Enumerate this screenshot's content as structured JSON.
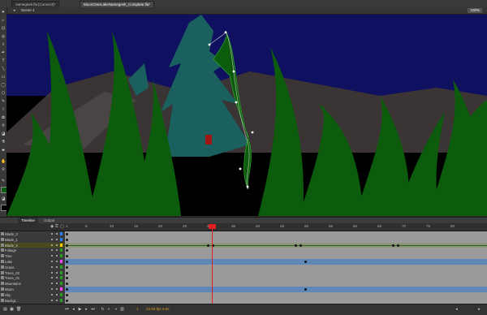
{
  "tabs": [
    {
      "label": "namegeek.fla [Connect]*",
      "active": false
    },
    {
      "label": "MoonOverLakeNamegeek_Complete.fla*",
      "active": true
    }
  ],
  "stage": {
    "scene_label": "Scene 1",
    "zoom": "100%"
  },
  "timeline": {
    "tabs": [
      "Timeline",
      "Output"
    ],
    "frame_numbers": [
      "1",
      "5",
      "10",
      "15",
      "20",
      "25",
      "30",
      "35",
      "40",
      "45",
      "50",
      "55",
      "60",
      "65",
      "70",
      "75",
      "80"
    ],
    "layers": [
      {
        "name": "Blade_3",
        "color": "#2a7fff",
        "keyframes": [
          1
        ]
      },
      {
        "name": "Blade_1",
        "color": "#2a7fff",
        "keyframes": [
          1
        ]
      },
      {
        "name": "Blade_2",
        "color": "#ffd000",
        "keyframes": [
          1,
          30,
          31,
          48,
          49,
          68,
          69
        ],
        "selected": true
      },
      {
        "name": "Foliage",
        "color": "#28a028",
        "keyframes": [
          1
        ]
      },
      {
        "name": "Tree",
        "color": "#28a028",
        "keyframes": [
          1
        ]
      },
      {
        "name": "Lake",
        "color": "#ff44ff",
        "keyframes": [
          1,
          50
        ],
        "highlight": true
      },
      {
        "name": "Grass",
        "color": "#28a028",
        "keyframes": [
          1
        ]
      },
      {
        "name": "Trees_02",
        "color": "#28a028",
        "keyframes": [
          1
        ]
      },
      {
        "name": "Trees_01",
        "color": "#28a028",
        "keyframes": [
          1
        ]
      },
      {
        "name": "Mountains",
        "color": "#28a028",
        "keyframes": [
          1
        ]
      },
      {
        "name": "Moon",
        "color": "#ff44ff",
        "keyframes": [
          1,
          50
        ],
        "highlight": true
      },
      {
        "name": "Sky",
        "color": "#28a028",
        "keyframes": [
          1
        ]
      },
      {
        "name": "Backgr...",
        "color": "#28a028",
        "keyframes": [
          1
        ]
      }
    ],
    "footer": {
      "fps": "24.00 fps",
      "time": "0.0s",
      "current_frame": "1"
    },
    "playhead_frame": 31
  },
  "colors": {
    "sky": "#101060",
    "grass": "#0d5c0d",
    "mountain": "#3b3434",
    "tree": "#19605e"
  }
}
